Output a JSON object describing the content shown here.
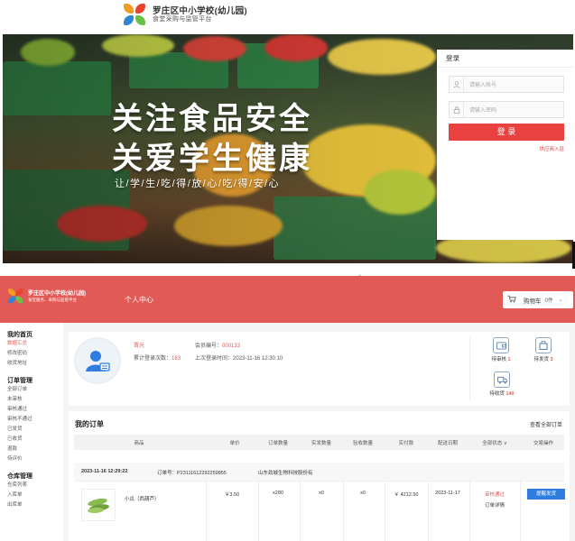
{
  "login_page": {
    "logo": {
      "school_name": "罗庄区中小学校(幼儿园)",
      "platform_name": "食堂采购与监管平台"
    },
    "banner": {
      "slogan_line1": "关注食品安全",
      "slogan_line2": "关爱学生健康",
      "slogan_line3": "让/学/生/吃/得/放/心/吃/得/安/心"
    },
    "login_form": {
      "title": "登录",
      "account_placeholder": "请输入账号",
      "password_placeholder": "请输入密码",
      "submit_label": "登 录",
      "forgot_label": "供应商入驻"
    }
  },
  "dashboard": {
    "header": {
      "school_name": "罗庄区中小学校(幼儿园)",
      "platform_name": "食堂服务、采购与监管平台",
      "nav_label": "个人中心",
      "cart_label": "购物车",
      "cart_count": "0件"
    },
    "sidebar": {
      "groups": [
        {
          "title": "我的首页",
          "items": [
            {
              "label": "数据汇总",
              "active": true
            },
            {
              "label": "修改密码",
              "active": false
            },
            {
              "label": "收货地址",
              "active": false
            }
          ]
        },
        {
          "title": "订单管理",
          "items": [
            {
              "label": "全部订单",
              "active": false
            },
            {
              "label": "未审核",
              "active": false
            },
            {
              "label": "审核通过",
              "active": false
            },
            {
              "label": "审核不通过",
              "active": false
            },
            {
              "label": "已发货",
              "active": false
            },
            {
              "label": "已收货",
              "active": false
            },
            {
              "label": "退款",
              "active": false
            },
            {
              "label": "待评价",
              "active": false
            }
          ]
        },
        {
          "title": "仓库管理",
          "items": [
            {
              "label": "仓库列表",
              "active": false
            },
            {
              "label": "入库单",
              "active": false
            },
            {
              "label": "出库单",
              "active": false
            }
          ]
        }
      ]
    },
    "profile": {
      "name": "晋光",
      "login_count_label": "累计登录次数：",
      "login_count": "163",
      "member_no_label": "会员编号：",
      "member_no": "000133",
      "last_login_label": "上次登录时间：",
      "last_login": "2023-11-16 12:30:10",
      "stats": [
        {
          "label": "待审核",
          "value": "1",
          "icon": "wallet-icon"
        },
        {
          "label": "待发货",
          "value": "3",
          "icon": "bag-icon"
        },
        {
          "label": "待收货",
          "value": "140",
          "icon": "truck-icon"
        }
      ]
    },
    "orders": {
      "title": "我的订单",
      "view_all": "查看全部订单",
      "columns": [
        "商品",
        "单价",
        "订单数量",
        "实发数量",
        "验收数量",
        "实付款",
        "配送日期",
        "全部状态",
        "交易操作"
      ],
      "status_chevron": "∨",
      "order": {
        "time": "2023-11-16 12:29:22",
        "order_no_label": "订单号：",
        "order_no": "P23111612292259855",
        "supplier": "山东劲城生物科技股份有",
        "product_name": "小瓜（西葫芦）",
        "unit_price": "￥3.50",
        "order_qty": "x280",
        "shipped_qty": "x0",
        "accepted_qty": "x0",
        "paid_amount": "￥ 4212.50",
        "delivery_date": "2023-11-17",
        "status": "审核通过",
        "detail_label": "订单详情",
        "action_label": "提醒发货"
      }
    }
  },
  "colors": {
    "brand_red": "#e25a55",
    "button_red": "#e94040",
    "action_blue": "#2f7de1"
  }
}
